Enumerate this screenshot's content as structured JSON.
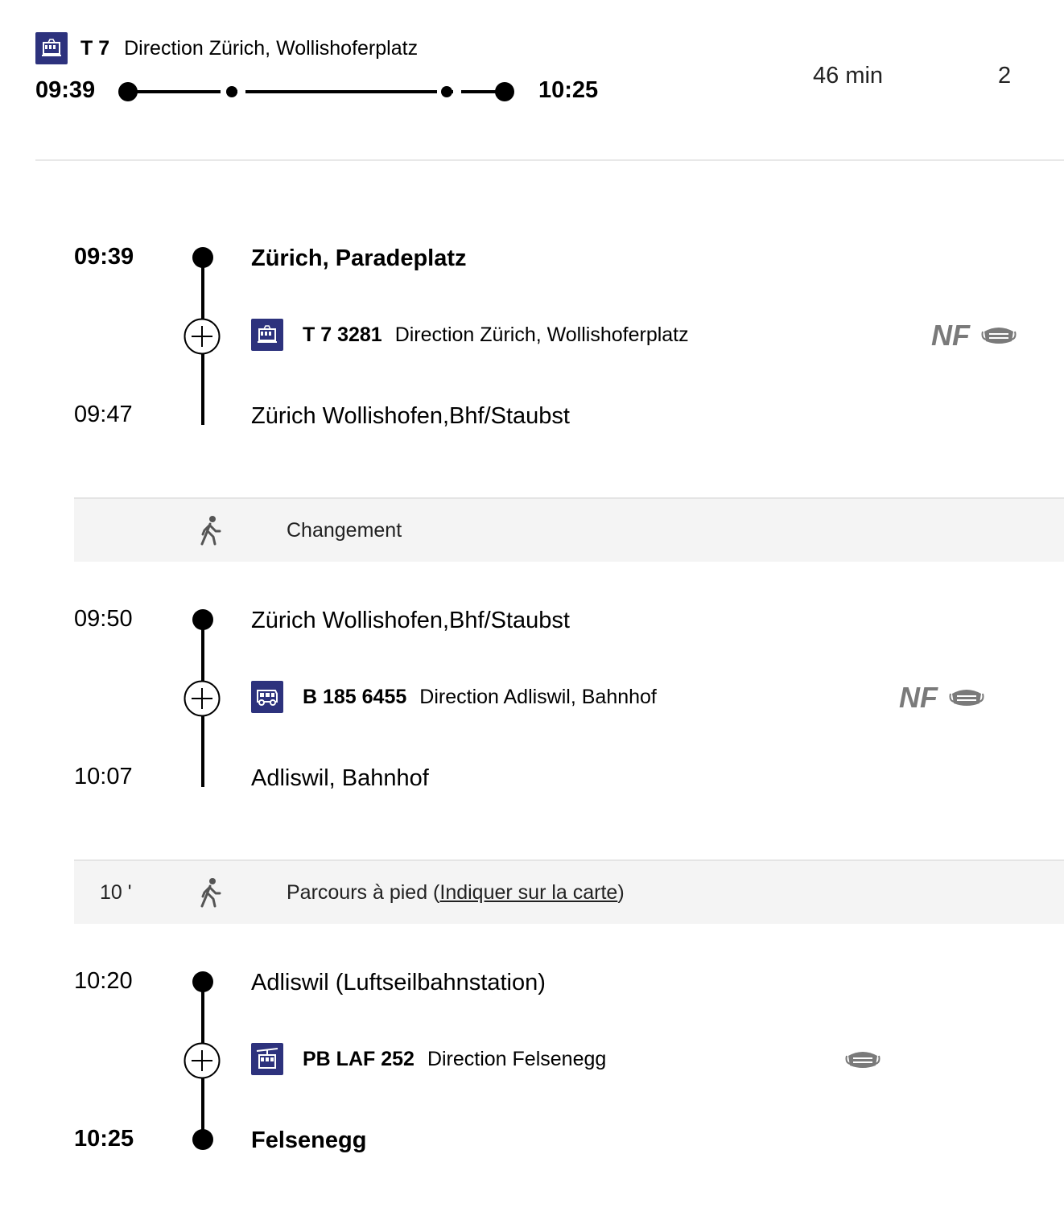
{
  "summary": {
    "line": "T 7",
    "direction": "Direction Zürich, Wollishoferplatz",
    "departure": "09:39",
    "arrival": "10:25",
    "duration": "46 min",
    "changes": "2",
    "vehicle_icon": "tram-icon"
  },
  "colors": {
    "vehicle_icon_bg": "#2d327d",
    "band_bg": "#f4f4f4",
    "attribute_gray": "#7a7a7a"
  },
  "legs": [
    {
      "dep_time": "09:39",
      "dep_stop": "Zürich, Paradeplatz",
      "vehicle_icon": "tram-icon",
      "line": "T 7 3281",
      "direction": "Direction Zürich, Wollishoferplatz",
      "nf": "NF",
      "arr_time": "09:47",
      "arr_stop": "Zürich Wollishofen,Bhf/Staubst"
    },
    {
      "dep_time": "09:50",
      "dep_stop": "Zürich Wollishofen,Bhf/Staubst",
      "vehicle_icon": "bus-icon",
      "line": "B 185 6455",
      "direction": "Direction Adliswil, Bahnhof",
      "nf": "NF",
      "arr_time": "10:07",
      "arr_stop": "Adliswil, Bahnhof"
    },
    {
      "dep_time": "10:20",
      "dep_stop": "Adliswil (Luftseilbahnstation)",
      "vehicle_icon": "cable-car-icon",
      "line": "PB LAF 252",
      "direction": "Direction Felsenegg",
      "arr_time": "10:25",
      "arr_stop": "Felsenegg"
    }
  ],
  "transfers": [
    {
      "duration": "",
      "text": "Changement",
      "icon": "walk-icon"
    },
    {
      "duration": "10 '",
      "text": "Parcours à pied ",
      "link_open": "(",
      "link": "Indiquer sur la carte",
      "link_close": ")",
      "icon": "walk-icon"
    }
  ]
}
